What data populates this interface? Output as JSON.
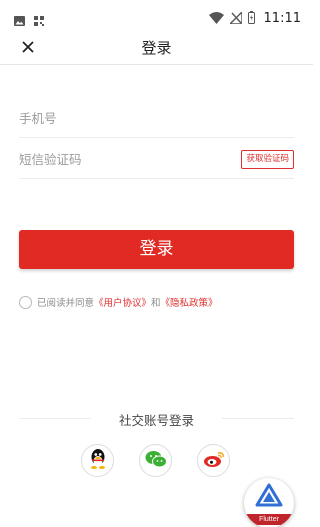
{
  "status_bar": {
    "time": "11:11",
    "left_icons": [
      "image-icon",
      "qr-code-icon"
    ],
    "right_icons": [
      "wifi-icon",
      "no-signal-icon",
      "battery-icon"
    ]
  },
  "app_bar": {
    "title": "登录",
    "close_icon": "close-icon"
  },
  "form": {
    "phone_placeholder": "手机号",
    "code_placeholder": "短信验证码",
    "get_code_label": "获取验证码"
  },
  "login_button": "登录",
  "agreement": {
    "prefix": "已阅读并同意",
    "user_agreement": "《用户协议》",
    "conjunction": "和",
    "privacy_policy": "《隐私政策》"
  },
  "social": {
    "title": "社交账号登录",
    "providers": [
      "qq-icon",
      "wechat-icon",
      "weibo-icon"
    ]
  },
  "badge": {
    "label": "Flutter"
  },
  "colors": {
    "accent": "#e02a23",
    "link": "#e02e2e"
  }
}
